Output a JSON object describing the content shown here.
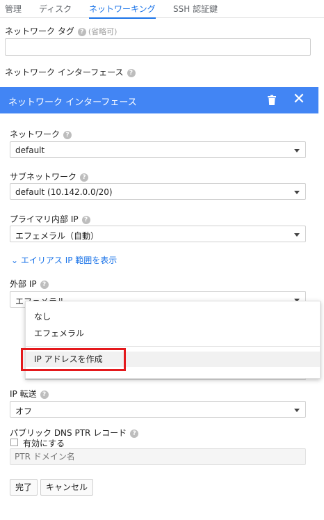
{
  "tabs": [
    {
      "label": "管理"
    },
    {
      "label": "ディスク"
    },
    {
      "label": "ネットワーキング",
      "active": true
    },
    {
      "label": "SSH 認証鍵"
    }
  ],
  "network_tag": {
    "label": "ネットワーク タグ",
    "optional": "(省略可)",
    "value": ""
  },
  "network_interfaces_label": "ネットワーク インターフェース",
  "panel": {
    "title": "ネットワーク インターフェース",
    "network": {
      "label": "ネットワーク",
      "value": "default"
    },
    "subnetwork": {
      "label": "サブネットワーク",
      "value": "default (10.142.0.0/20)"
    },
    "primary_internal_ip": {
      "label": "プライマリ内部 IP",
      "value": "エフェメラル（自動）"
    },
    "alias_link": "エイリアス IP 範囲を表示",
    "external_ip": {
      "label": "外部 IP",
      "value": "エフェメラル"
    },
    "external_ip_options": [
      "なし",
      "エフェメラル",
      "IP アドレスを作成"
    ],
    "ip_forwarding": {
      "label": "IP 転送",
      "value": "オフ"
    },
    "public_dns_ptr": {
      "label": "パブリック DNS PTR レコード",
      "checkbox_label": "有効にする",
      "placeholder": "PTR ドメイン名"
    },
    "done_button": "完了",
    "cancel_button": "キャンセル"
  },
  "colors": {
    "accent": "#1a73e8",
    "header": "#4285f4",
    "highlight": "#e4191c"
  }
}
